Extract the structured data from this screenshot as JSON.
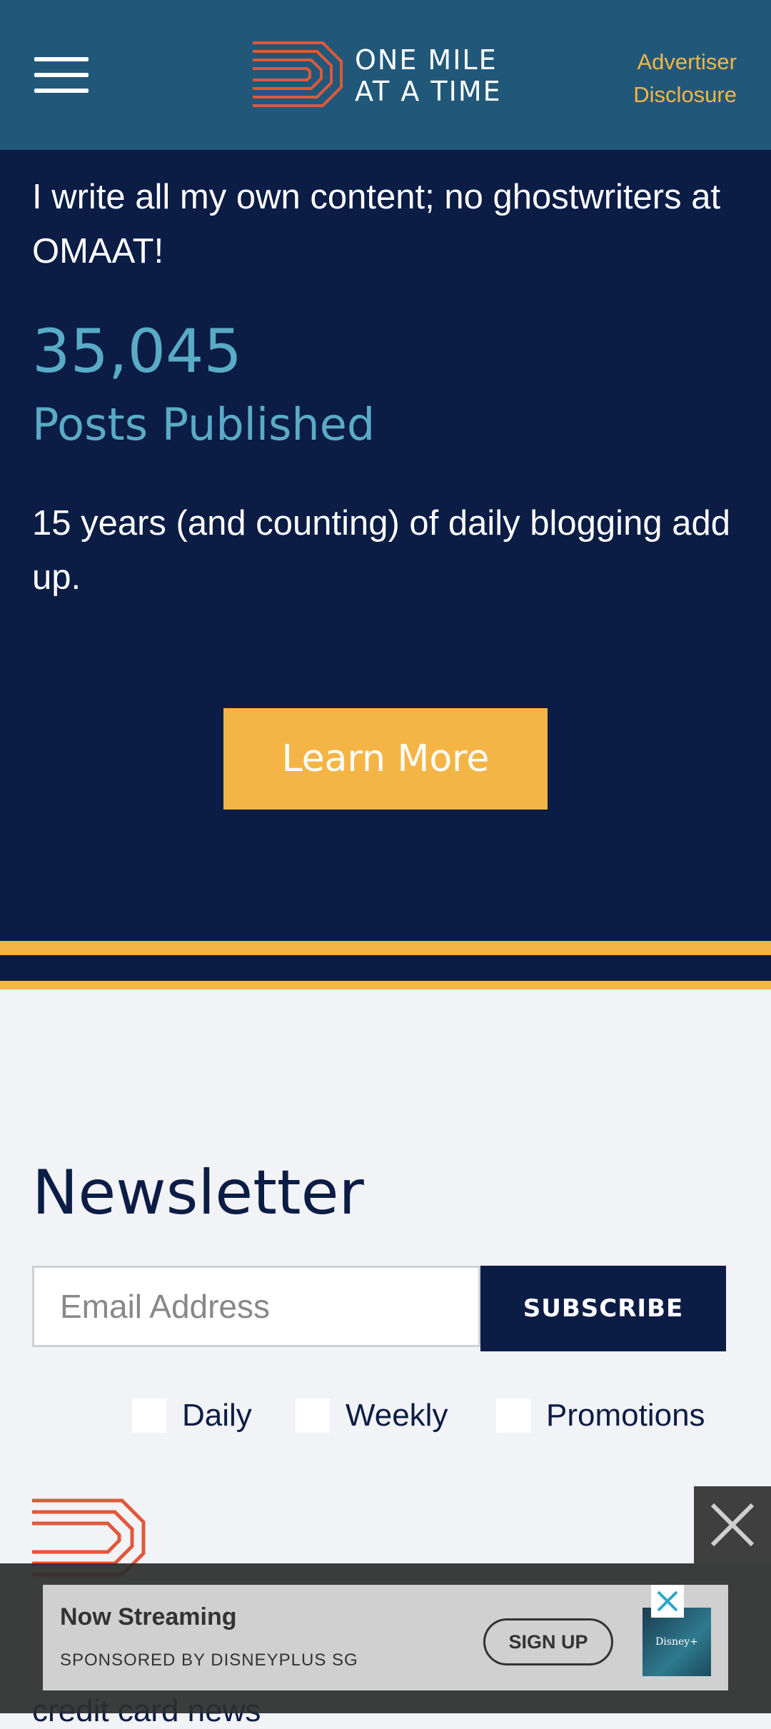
{
  "header": {
    "logo_line1": "ONE MILE",
    "logo_line2": "AT A TIME",
    "disclosure_line1": "Advertiser",
    "disclosure_line2": "Disclosure"
  },
  "promo": {
    "intro": "I write all my own content; no ghostwriters at OMAAT!",
    "stat_number": "35,045",
    "stat_label": "Posts Published",
    "blurb": "15 years (and counting) of daily blogging add up.",
    "cta_label": "Learn More"
  },
  "newsletter": {
    "title": "Newsletter",
    "email_placeholder": "Email Address",
    "subscribe_label": "SUBSCRIBE",
    "options": [
      "Daily",
      "Weekly",
      "Promotions"
    ]
  },
  "footer": {
    "partial_line": "credit card news"
  },
  "ad": {
    "title": "Now Streaming",
    "sponsor": "SPONSORED BY DISNEYPLUS SG",
    "cta_label": "SIGN UP",
    "thumb_text": "Disney+"
  },
  "colors": {
    "header_bg": "#215879",
    "navy": "#0b1c45",
    "accent_gold": "#f5b546",
    "stat_blue": "#5aabc5",
    "logo_orange": "#e0583a",
    "page_bg": "#f2f3f7"
  }
}
